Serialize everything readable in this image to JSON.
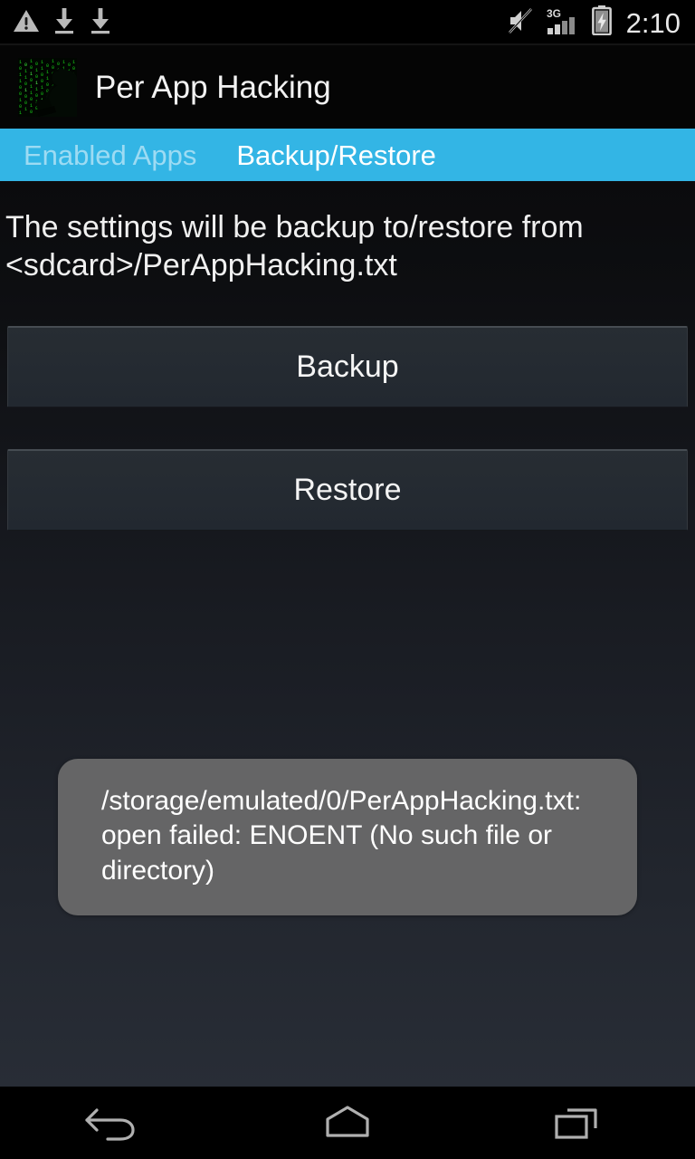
{
  "status_bar": {
    "left_icons": [
      {
        "name": "warning-triangle-icon",
        "label": "warning"
      },
      {
        "name": "download-icon",
        "label": "download"
      },
      {
        "name": "download-icon-2",
        "label": "download"
      }
    ],
    "right_icons": [
      {
        "name": "volume-muted-icon",
        "label": "silent mode"
      },
      {
        "name": "signal-3g-icon",
        "label": "3G"
      },
      {
        "name": "battery-charging-icon",
        "label": "charging"
      }
    ],
    "network_label": "3G",
    "clock": "2:10"
  },
  "header": {
    "app_icon": "matrix-hacker-icon",
    "title": "Per App Hacking"
  },
  "tabs": [
    {
      "label": "Enabled Apps",
      "active": false
    },
    {
      "label": "Backup/Restore",
      "active": true
    }
  ],
  "main": {
    "description": "The settings will be backup to/restore from <sdcard>/PerAppHacking.txt",
    "buttons": [
      {
        "label": "Backup"
      },
      {
        "label": "Restore"
      }
    ]
  },
  "toast": {
    "message": "/storage/emulated/0/PerAppHacking.txt: open failed: ENOENT (No such file or directory)"
  },
  "nav_bar": [
    {
      "name": "back-icon",
      "label": "Back"
    },
    {
      "name": "home-icon",
      "label": "Home"
    },
    {
      "name": "recents-icon",
      "label": "Recent apps"
    }
  ],
  "colors": {
    "accent_blue": "#33b5e5",
    "status_bar_bg": "#000000",
    "header_bg": "#050505",
    "button_bg": "#272d33",
    "toast_bg": "#6b6b6b",
    "text_primary": "#f2f2f2",
    "icon_green": "#2ecc2e"
  }
}
